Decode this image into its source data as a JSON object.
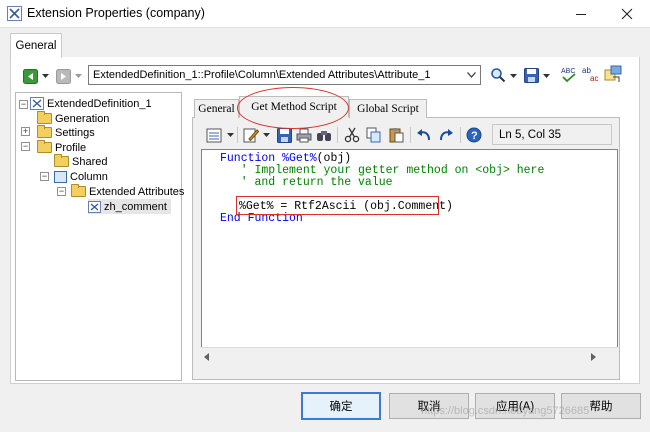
{
  "window": {
    "title": "Extension Properties (company)"
  },
  "main_tab": {
    "label": "General"
  },
  "path": {
    "value": "ExtendedDefinition_1::Profile\\Column\\Extended Attributes\\Attribute_1"
  },
  "tree": {
    "root": "ExtendedDefinition_1",
    "generation": "Generation",
    "settings": "Settings",
    "profile": "Profile",
    "shared": "Shared",
    "column": "Column",
    "extended_attributes": "Extended Attributes",
    "zh_comment": "zh_comment"
  },
  "sub_tabs": {
    "general": "General",
    "get_method": "Get Method Script",
    "global": "Global Script"
  },
  "editor": {
    "position": "Ln 5, Col 35",
    "line1_kw": "Function ",
    "line1_name": "%Get%",
    "line1_rest": "(obj)",
    "line2": "   ' Implement your getter method on <obj> here",
    "line3": "   ' and return the value",
    "line5": "%Get% = Rtf2Ascii (obj.Comment)",
    "line6": "End Function"
  },
  "buttons": {
    "ok": "确定",
    "cancel": "取消",
    "apply": "应用(A)",
    "help": "帮助"
  },
  "watermark": "https://blog.csdn.net/yang5726685",
  "colors": {
    "keyword": "#0000ff",
    "comment": "#008000",
    "highlight": "#d9332e"
  }
}
